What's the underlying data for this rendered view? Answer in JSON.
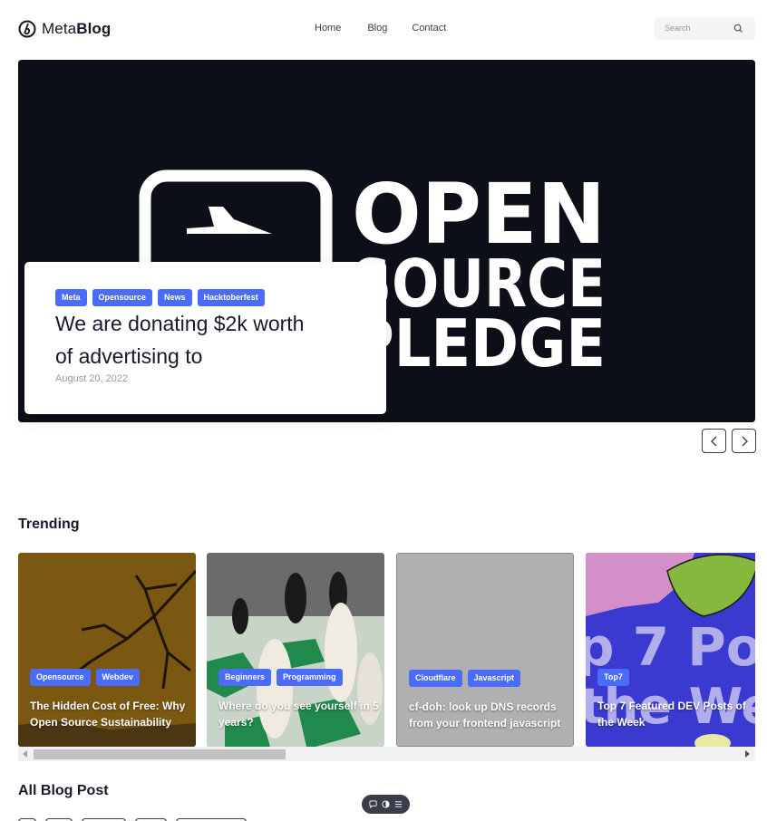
{
  "brand": {
    "name_light": "Meta",
    "name_bold": "Blog",
    "accent": "#4b6bfb"
  },
  "nav": {
    "items": [
      "Home",
      "Blog",
      "Contact"
    ]
  },
  "search": {
    "placeholder": "Search"
  },
  "hero": {
    "image_text": [
      "OPEN",
      "SOURCE",
      "PLEDGE"
    ],
    "tags": [
      "Meta",
      "Opensource",
      "News",
      "Hacktoberfest"
    ],
    "title": "We are donating $2k worth of advertising to",
    "date": "August 20, 2022"
  },
  "sections": {
    "trending": "Trending",
    "all_posts": "All Blog Post"
  },
  "trending": [
    {
      "tags": [
        "Opensource",
        "Webdev"
      ],
      "title": "The Hidden Cost of Free: Why Open Source Sustainability"
    },
    {
      "tags": [
        "Beginners",
        "Programming"
      ],
      "title": "Where do you see yourself in 5 years?"
    },
    {
      "tags": [
        "Cloudflare",
        "Javascript"
      ],
      "title": "cf-doh: look up DNS records from your frontend javascript"
    },
    {
      "tags": [
        "Top7"
      ],
      "title": "Top 7 Featured DEV Posts of the Week",
      "image_text": [
        "p 7 Po",
        "the We"
      ]
    }
  ],
  "icons": [
    "brand-logo-icon",
    "search-icon",
    "chevron-left-icon",
    "chevron-right-icon",
    "comment-icon",
    "theme-toggle-icon",
    "menu-icon"
  ]
}
